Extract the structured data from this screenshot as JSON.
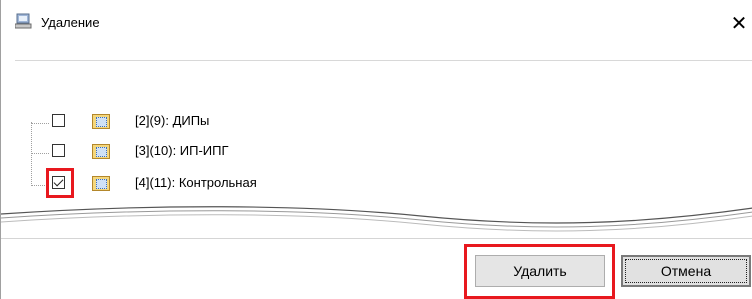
{
  "window": {
    "title": "Удаление",
    "close_glyph": "✕"
  },
  "tree": {
    "items": [
      {
        "label": "[2](9): ДИПы",
        "checked": false
      },
      {
        "label": "[3](10): ИП-ИПГ",
        "checked": false
      },
      {
        "label": "[4](11): Контрольная",
        "checked": true
      }
    ]
  },
  "buttons": {
    "delete_label": "Удалить",
    "cancel_label": "Отмена"
  },
  "colors": {
    "highlight": "#e8181e"
  }
}
